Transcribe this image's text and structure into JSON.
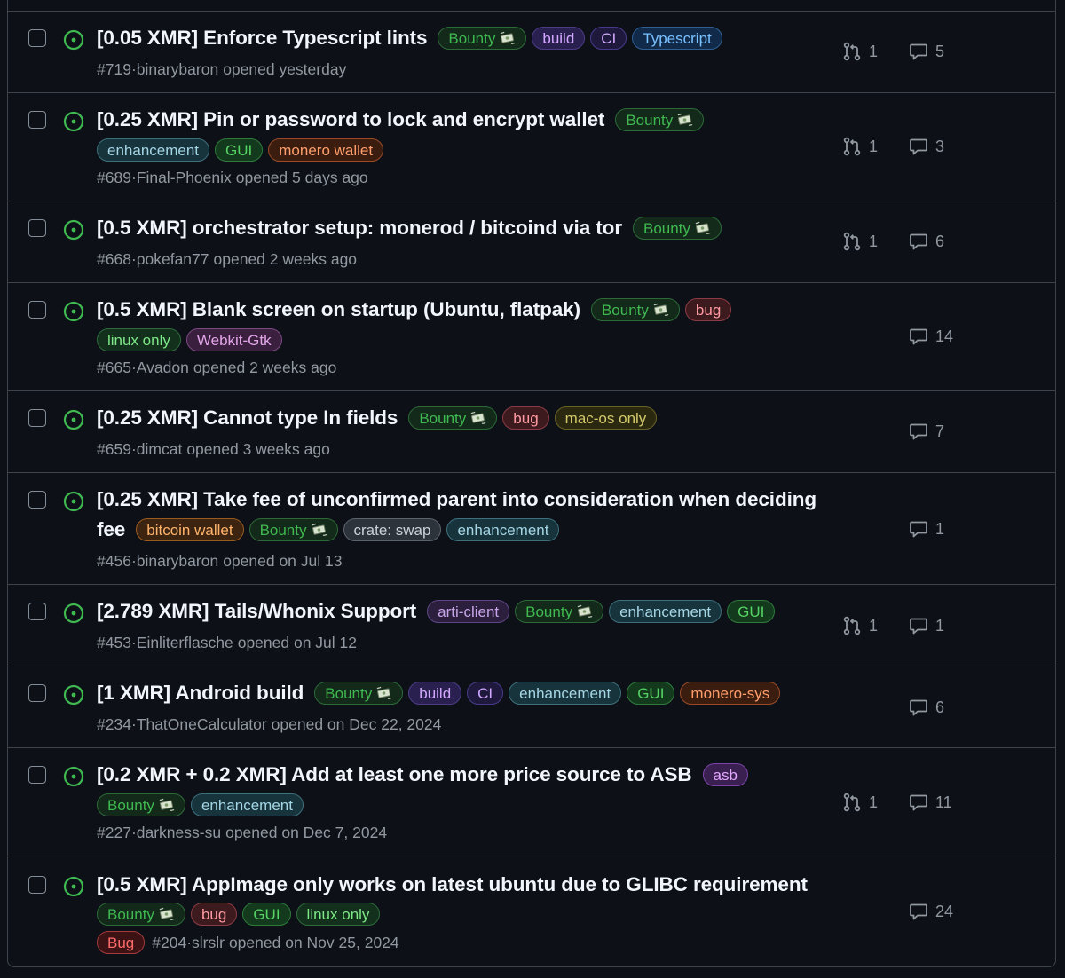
{
  "label_styles": {
    "Bounty": {
      "text": "#3fb950",
      "bg": "#13291a",
      "border": "#2d6a38",
      "icon": "money-with-wings-icon"
    },
    "build": {
      "text": "#d2a8ff",
      "bg": "#2a2050",
      "border": "#4c3c85"
    },
    "CI": {
      "text": "#d2a8ff",
      "bg": "#1f1a3d",
      "border": "#473a8a"
    },
    "Typescript": {
      "text": "#79c0ff",
      "bg": "#112a4a",
      "border": "#2f5f93"
    },
    "enhancement": {
      "text": "#a5d6e6",
      "bg": "#17333b",
      "border": "#3d6f7d"
    },
    "GUI": {
      "text": "#56d364",
      "bg": "#143a1e",
      "border": "#2e7a3a"
    },
    "monero wallet": {
      "text": "#ff9e6b",
      "bg": "#3b1d10",
      "border": "#9a4a25"
    },
    "bug": {
      "text": "#ff9aa2",
      "bg": "#3d1a1e",
      "border": "#8c3b44"
    },
    "linux only": {
      "text": "#7ee787",
      "bg": "#12301c",
      "border": "#2f6b3c"
    },
    "Webkit-Gtk": {
      "text": "#e2a6e8",
      "bg": "#3b1f3f",
      "border": "#7a4a80"
    },
    "mac-os only": {
      "text": "#d4c96a",
      "bg": "#2b2810",
      "border": "#6b6326"
    },
    "bitcoin wallet": {
      "text": "#ffb46b",
      "bg": "#3d2410",
      "border": "#9a5a20"
    },
    "crate: swap": {
      "text": "#c9d1d9",
      "bg": "#2d333b",
      "border": "#5b636d"
    },
    "arti-client": {
      "text": "#c8a5e8",
      "bg": "#2b1f3d",
      "border": "#5e4585"
    },
    "monero-sys": {
      "text": "#ff9e6b",
      "bg": "#3b1d10",
      "border": "#9a4a25"
    },
    "asb": {
      "text": "#e2a6ff",
      "bg": "#3a2050",
      "border": "#7a44a8"
    },
    "Bug": {
      "text": "#ff6b6b",
      "bg": "#3d1214",
      "border": "#a33a3d"
    }
  },
  "issues": [
    {
      "lines": [
        [
          "[0.05 XMR] Enforce Typescript lints",
          "Bounty",
          "build",
          "CI",
          "Typescript"
        ]
      ],
      "number": "#719",
      "author": "binarybaron",
      "opened": "opened yesterday",
      "prs": "1",
      "comments": "5"
    },
    {
      "lines": [
        [
          "[0.25 XMR] Pin or password to lock and encrypt wallet",
          "Bounty"
        ],
        [
          "enhancement",
          "GUI",
          "monero wallet"
        ]
      ],
      "number": "#689",
      "author": "Final-Phoenix",
      "opened": "opened 5 days ago",
      "prs": "1",
      "comments": "3"
    },
    {
      "lines": [
        [
          "[0.5 XMR] orchestrator setup: monerod / bitcoind via tor",
          "Bounty"
        ]
      ],
      "number": "#668",
      "author": "pokefan77",
      "opened": "opened 2 weeks ago",
      "prs": "1",
      "comments": "6"
    },
    {
      "lines": [
        [
          "[0.5 XMR] Blank screen on startup (Ubuntu, flatpak)",
          "Bounty",
          "bug"
        ],
        [
          "linux only",
          "Webkit-Gtk"
        ]
      ],
      "number": "#665",
      "author": "Avadon",
      "opened": "opened 2 weeks ago",
      "prs": null,
      "comments": "14"
    },
    {
      "lines": [
        [
          "[0.25 XMR] Cannot type In fields",
          "Bounty",
          "bug",
          "mac-os only"
        ]
      ],
      "number": "#659",
      "author": "dimcat",
      "opened": "opened 3 weeks ago",
      "prs": null,
      "comments": "7"
    },
    {
      "lines": [
        [
          "[0.25 XMR] Take fee of unconfirmed parent into consideration when deciding"
        ],
        [
          "fee",
          "bitcoin wallet",
          "Bounty",
          "crate: swap",
          "enhancement"
        ]
      ],
      "number": "#456",
      "author": "binarybaron",
      "opened": "opened on Jul 13",
      "prs": null,
      "comments": "1"
    },
    {
      "lines": [
        [
          "[2.789 XMR] Tails/Whonix Support",
          "arti-client",
          "Bounty",
          "enhancement",
          "GUI"
        ]
      ],
      "number": "#453",
      "author": "Einliterflasche",
      "opened": "opened on Jul 12",
      "prs": "1",
      "comments": "1"
    },
    {
      "lines": [
        [
          "[1 XMR] Android build",
          "Bounty",
          "build",
          "CI",
          "enhancement",
          "GUI",
          "monero-sys"
        ]
      ],
      "number": "#234",
      "author": "ThatOneCalculator",
      "opened": "opened on Dec 22, 2024",
      "prs": null,
      "comments": "6"
    },
    {
      "lines": [
        [
          "[0.2 XMR + 0.2 XMR] Add at least one more price source to ASB",
          "asb"
        ],
        [
          "Bounty",
          "enhancement"
        ]
      ],
      "number": "#227",
      "author": "darkness-su",
      "opened": "opened on Dec 7, 2024",
      "prs": "1",
      "comments": "11"
    },
    {
      "lines": [
        [
          "[0.5 XMR] AppImage only works on latest ubuntu due to GLIBC requirement"
        ],
        [
          "Bounty",
          "bug",
          "GUI",
          "linux only"
        ]
      ],
      "meta_label": "Bug",
      "number": "#204",
      "author": "slrslr",
      "opened": "opened on Nov 25, 2024",
      "prs": null,
      "comments": "24"
    }
  ]
}
